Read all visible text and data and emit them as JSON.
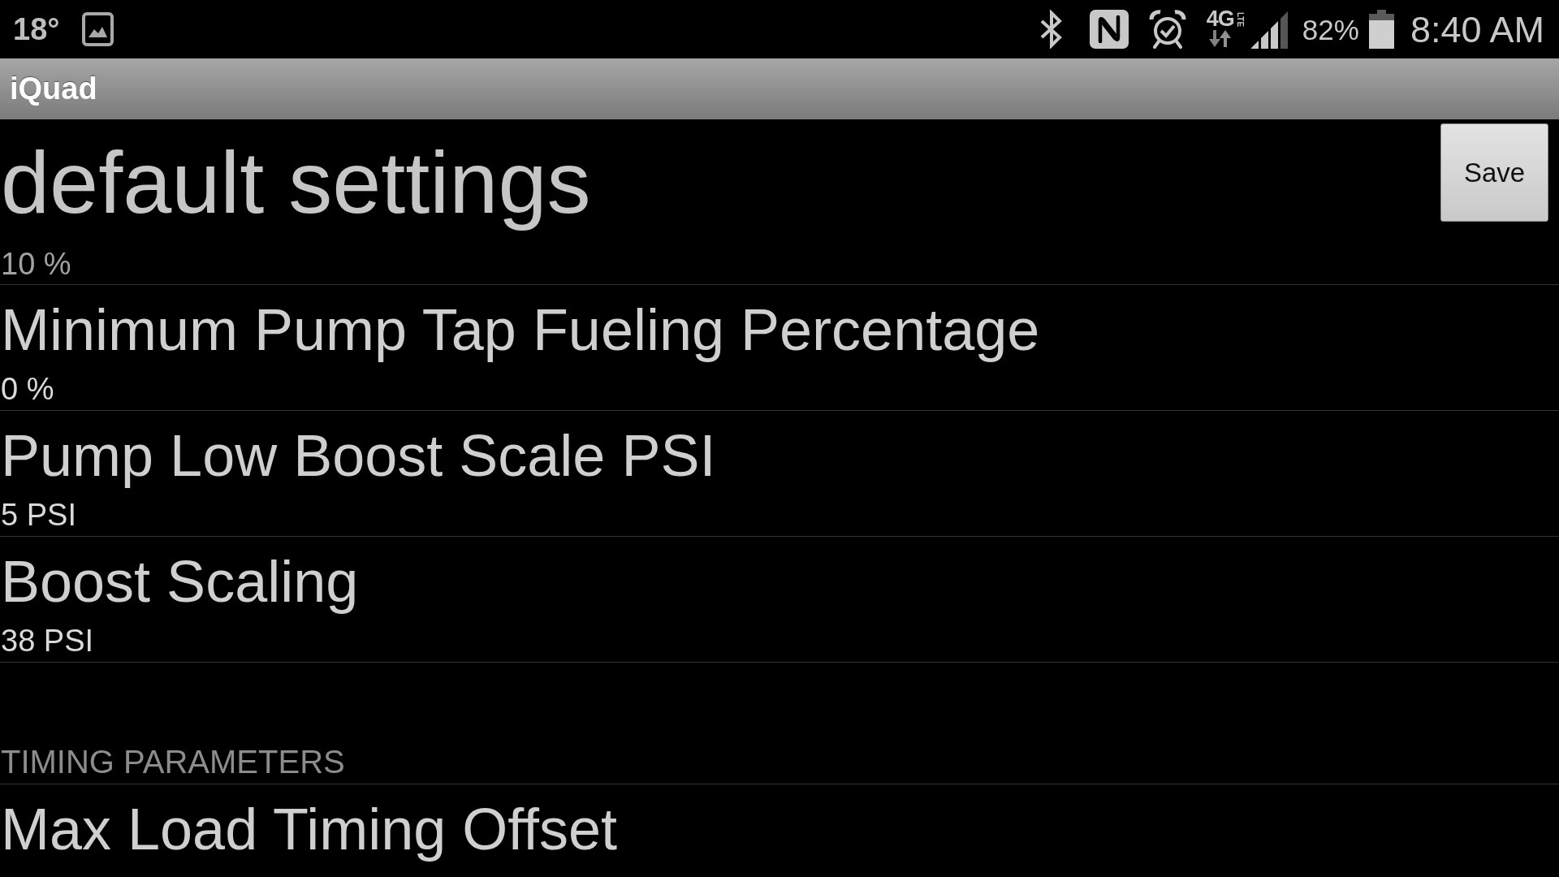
{
  "status_bar": {
    "temperature": "18°",
    "network_type": "4G",
    "network_subtype": "LTE",
    "battery": "82%",
    "time": "8:40 AM"
  },
  "action_bar": {
    "title": "iQuad"
  },
  "header": {
    "title": "default settings",
    "summary": "10 %",
    "save_button": "Save"
  },
  "preferences": [
    {
      "kind": "item",
      "title": "Minimum Pump Tap Fueling Percentage",
      "summary": "0 %"
    },
    {
      "kind": "item",
      "title": "Pump Low Boost Scale PSI",
      "summary": "5 PSI"
    },
    {
      "kind": "item",
      "title": "Boost Scaling",
      "summary": "38 PSI"
    },
    {
      "kind": "category",
      "title": "TIMING PARAMETERS"
    },
    {
      "kind": "item",
      "title": "Max Load Timing Offset"
    }
  ]
}
